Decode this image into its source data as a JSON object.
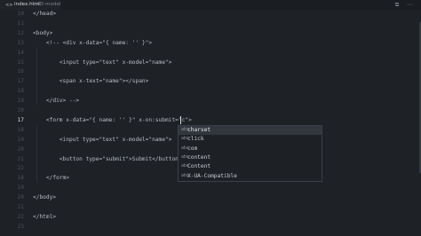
{
  "tab": {
    "icon": "<>",
    "name": "index.html",
    "path": "03-model"
  },
  "titlebar_icons": {
    "split": "⧉",
    "more": "⋯"
  },
  "editor": {
    "lines": [
      {
        "num": "10",
        "text": "</head>"
      },
      {
        "num": "11",
        "text": ""
      },
      {
        "num": "12",
        "text": "<body>"
      },
      {
        "num": "13",
        "text": "    <!-- <div x-data=\"{ name: '' }\">"
      },
      {
        "num": "14",
        "text": ""
      },
      {
        "num": "15",
        "text": "        <input type=\"text\" x-model=\"name\">"
      },
      {
        "num": "16",
        "text": ""
      },
      {
        "num": "17",
        "text": "        <span x-text=\"name\"></span>"
      },
      {
        "num": "18",
        "text": ""
      },
      {
        "num": "19",
        "text": "    </div> -->"
      },
      {
        "num": "20",
        "text": ""
      },
      {
        "num": "17",
        "text": "    <form x-data=\"{ name: '' }\" x-on:submit=\"c\">",
        "active": true
      },
      {
        "num": "18",
        "text": ""
      },
      {
        "num": "19",
        "text": "        <input type=\"text\" x-model=\"name\">"
      },
      {
        "num": "20",
        "text": ""
      },
      {
        "num": "21",
        "text": "        <button type=\"submit\">Submit</button>"
      },
      {
        "num": "22",
        "text": ""
      },
      {
        "num": "18",
        "text": "    </form>"
      },
      {
        "num": "19",
        "text": ""
      },
      {
        "num": "20",
        "text": "</body>"
      },
      {
        "num": "21",
        "text": ""
      },
      {
        "num": "22",
        "text": "</html>"
      },
      {
        "num": "23",
        "text": ""
      }
    ]
  },
  "suggestions": {
    "kind_icon": "abc",
    "items": [
      {
        "label": "charset",
        "selected": true
      },
      {
        "label": "click"
      },
      {
        "label": "com"
      },
      {
        "label": "content"
      },
      {
        "label": "Content"
      },
      {
        "label": "X-UA-Compatible"
      }
    ]
  }
}
